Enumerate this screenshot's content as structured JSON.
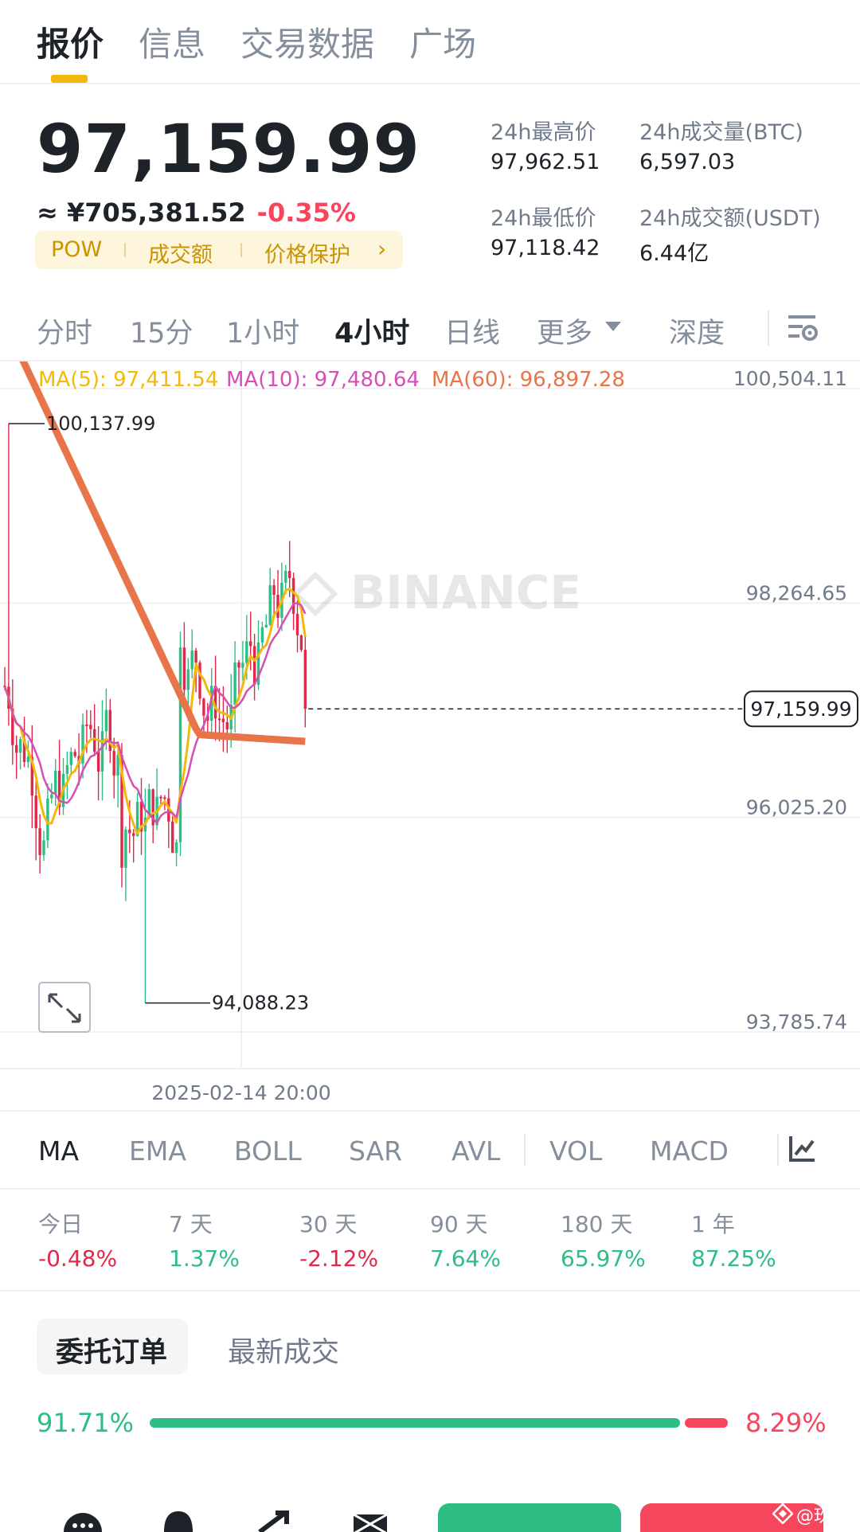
{
  "top_tabs": [
    "报价",
    "信息",
    "交易数据",
    "广场"
  ],
  "price": {
    "last": "97,159.99",
    "cny": "≈ ¥705,381.52",
    "change": "-0.35%"
  },
  "tags": [
    "POW",
    "成交额",
    "价格保护"
  ],
  "stats": {
    "high_label": "24h最高价",
    "high_value": "97,962.51",
    "vol_btc_label": "24h成交量(BTC)",
    "vol_btc_value": "6,597.03",
    "low_label": "24h最低价",
    "low_value": "97,118.42",
    "vol_usdt_label": "24h成交额(USDT)",
    "vol_usdt_value": "6.44亿"
  },
  "intervals": [
    "分时",
    "15分",
    "1小时",
    "4小时",
    "日线",
    "更多",
    "深度"
  ],
  "active_interval": "4小时",
  "ma": {
    "ma5": "MA(5): 97,411.54",
    "ma10": "MA(10): 97,480.64",
    "ma60": "MA(60): 96,897.28"
  },
  "chart_data": {
    "type": "candlestick",
    "y_ticks": [
      "100,504.11",
      "98,264.65",
      "96,025.20",
      "93,785.74"
    ],
    "ylim": [
      93785.74,
      100504.11
    ],
    "high_marker": "100,137.99",
    "low_marker": "94,088.23",
    "current_price_label": "97,159.99",
    "x_label": "2025-02-14 20:00",
    "watermark": "BINANCE",
    "colors": {
      "up": "#2ebd85",
      "down": "#e0294a",
      "ma5": "#f0b90b",
      "ma10": "#d54fb5",
      "ma60": "#e8744a"
    }
  },
  "indicators": [
    "MA",
    "EMA",
    "BOLL",
    "SAR",
    "AVL",
    "VOL",
    "MACD"
  ],
  "performance": [
    {
      "label": "今日",
      "value": "-0.48%",
      "dir": "down"
    },
    {
      "label": "7 天",
      "value": "1.37%",
      "dir": "up"
    },
    {
      "label": "30 天",
      "value": "-2.12%",
      "dir": "down"
    },
    {
      "label": "90 天",
      "value": "7.64%",
      "dir": "up"
    },
    {
      "label": "180 天",
      "value": "65.97%",
      "dir": "up"
    },
    {
      "label": "1 年",
      "value": "87.25%",
      "dir": "up"
    }
  ],
  "order_tabs": [
    "委托订单",
    "最新成交"
  ],
  "ratio": {
    "buy": "91.71%",
    "sell": "8.29%",
    "buy_fraction": 0.9171
  },
  "watermark_user": "@玖叔"
}
